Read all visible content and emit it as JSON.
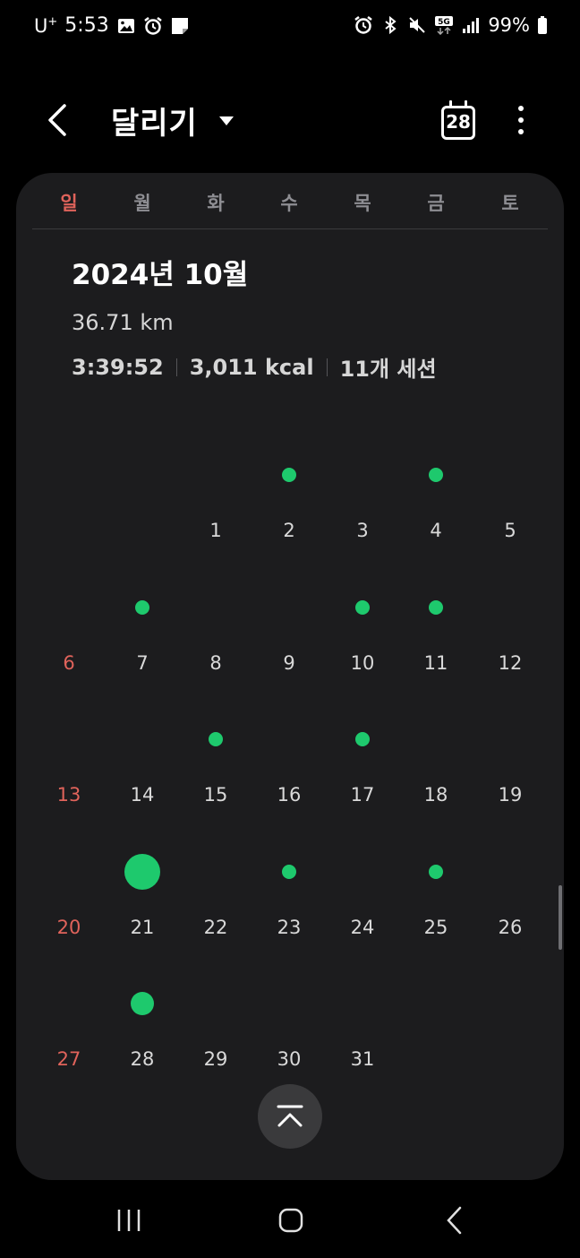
{
  "status_bar": {
    "carrier": "U",
    "carrier_sup": "+",
    "time": "5:53",
    "battery": "99%",
    "network": "5G",
    "left_icons": [
      "gallery-icon",
      "alarm-icon",
      "note-icon"
    ],
    "right_icons": [
      "alarm-icon",
      "bluetooth-icon",
      "mute-icon",
      "5g-icon",
      "signal-icon",
      "battery-icon"
    ]
  },
  "header": {
    "title": "달리기",
    "calendar_day": "28"
  },
  "weekdays": [
    "일",
    "월",
    "화",
    "수",
    "목",
    "금",
    "토"
  ],
  "summary": {
    "month": "2024년 10월",
    "distance": "36.71 km",
    "duration": "3:39:52",
    "calories": "3,011 kcal",
    "sessions": "11개 세션"
  },
  "calendar": {
    "weeks": [
      [
        {
          "day": ""
        },
        {
          "day": ""
        },
        {
          "day": "1",
          "activity": "none"
        },
        {
          "day": "2",
          "activity": "small"
        },
        {
          "day": "3",
          "activity": "none"
        },
        {
          "day": "4",
          "activity": "small"
        },
        {
          "day": "5",
          "activity": "none"
        }
      ],
      [
        {
          "day": "6",
          "activity": "none"
        },
        {
          "day": "7",
          "activity": "small"
        },
        {
          "day": "8",
          "activity": "none"
        },
        {
          "day": "9",
          "activity": "none"
        },
        {
          "day": "10",
          "activity": "small"
        },
        {
          "day": "11",
          "activity": "small"
        },
        {
          "day": "12",
          "activity": "none"
        }
      ],
      [
        {
          "day": "13",
          "activity": "none"
        },
        {
          "day": "14",
          "activity": "none"
        },
        {
          "day": "15",
          "activity": "small"
        },
        {
          "day": "16",
          "activity": "none"
        },
        {
          "day": "17",
          "activity": "small"
        },
        {
          "day": "18",
          "activity": "none"
        },
        {
          "day": "19",
          "activity": "none"
        }
      ],
      [
        {
          "day": "20",
          "activity": "none"
        },
        {
          "day": "21",
          "activity": "large"
        },
        {
          "day": "22",
          "activity": "none"
        },
        {
          "day": "23",
          "activity": "small"
        },
        {
          "day": "24",
          "activity": "none"
        },
        {
          "day": "25",
          "activity": "small"
        },
        {
          "day": "26",
          "activity": "none"
        }
      ],
      [
        {
          "day": "27",
          "activity": "none"
        },
        {
          "day": "28",
          "activity": "medium"
        },
        {
          "day": "29",
          "activity": "none"
        },
        {
          "day": "30",
          "activity": "none"
        },
        {
          "day": "31",
          "activity": "none"
        },
        {
          "day": ""
        },
        {
          "day": ""
        }
      ]
    ]
  },
  "colors": {
    "background": "#000000",
    "card": "#1c1c1e",
    "activity_dot": "#1ec96d",
    "sunday": "#e0635b",
    "weekday": "#8e8e93"
  },
  "icons": {
    "back": "back-arrow-icon",
    "dropdown": "caret-down-icon",
    "calendar": "calendar-icon",
    "more": "more-vertical-icon",
    "scroll_top": "chevron-up-icon",
    "nav": [
      "recent-apps-icon",
      "home-icon",
      "back-icon"
    ]
  }
}
